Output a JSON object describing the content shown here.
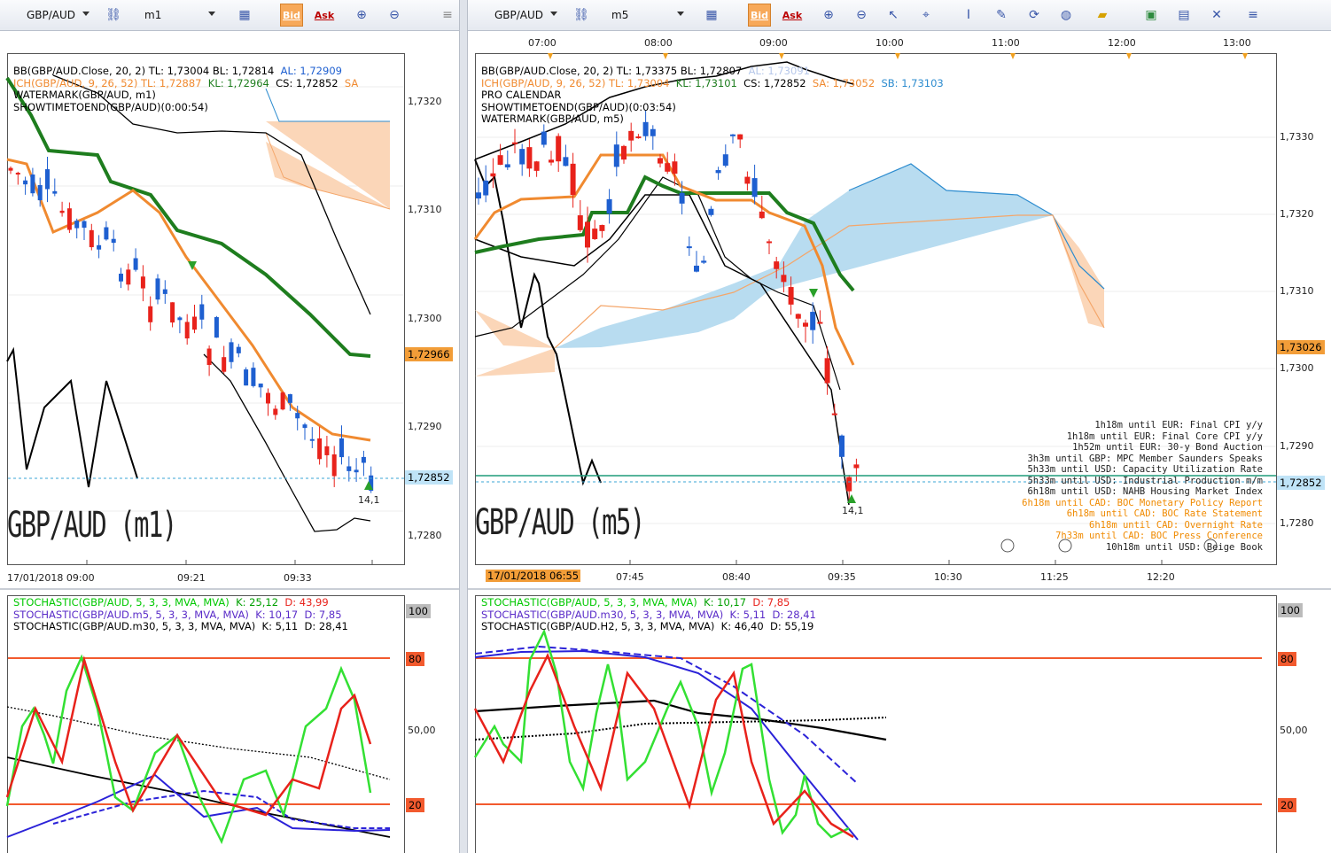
{
  "left": {
    "toolbar": {
      "symbol": "GBP/AUD",
      "timeframe": "m1",
      "bid": "Bid",
      "ask": "Ask"
    },
    "legend": [
      {
        "text": "BB(GBP/AUD.Close, 20, 2)  TL: 1,73004  BL: 1,72814",
        "extra": "AL: 1,72909"
      },
      {
        "text": "ICH(GBP/AUD, 9, 26, 52)  TL: 1,72887",
        "kl": "KL: 1,72964",
        "cs": "CS: 1,72852",
        "sa": "SA"
      },
      {
        "text": "WATERMARK(GBP/AUD, m1)"
      },
      {
        "text": "SHOWTIMETOEND(GBP/AUD)(0:00:54)"
      }
    ],
    "price_axis": [
      "1,7320",
      "1,7310",
      "1,7300",
      "1,7290",
      "1,7280"
    ],
    "tag_orange": "1,72966",
    "tag_blue": "1,72852",
    "time_axis": [
      "17/01/2018 09:00",
      "09:21",
      "09:33"
    ],
    "watermark": "GBP/AUD (m1)",
    "tick_label": "14,1",
    "stoch_legend": [
      {
        "label": "STOCHASTIC(GBP/AUD, 5, 3, 3, MVA, MVA)",
        "k": "K: 25,12",
        "d": "D: 43,99",
        "color": "#00c800"
      },
      {
        "label": "STOCHASTIC(GBP/AUD.m5, 5, 3, 3, MVA, MVA)",
        "k": "K: 10,17",
        "d": "D: 7,85",
        "color": "#5a2cc8"
      },
      {
        "label": "STOCHASTIC(GBP/AUD.m30, 5, 3, 3, MVA, MVA)",
        "k": "K: 5,11",
        "d": "D: 28,41",
        "color": "#000000"
      }
    ],
    "stoch_axis": [
      "100",
      "80",
      "50,00",
      "20"
    ]
  },
  "right": {
    "toolbar": {
      "symbol": "GBP/AUD",
      "timeframe": "m5",
      "bid": "Bid",
      "ask": "Ask"
    },
    "top_times": [
      "07:00",
      "08:00",
      "09:00",
      "10:00",
      "11:00",
      "12:00",
      "13:00"
    ],
    "legend": [
      {
        "text": "BB(GBP/AUD.Close, 20, 2)  TL: 1,73375  BL: 1,72807",
        "extra": "AL: 1,73091"
      },
      {
        "text": "ICH(GBP/AUD, 9, 26, 52)  TL: 1,73004",
        "kl": "KL: 1,73101",
        "cs": "CS: 1,72852",
        "sa": "SA: 1,73052",
        "sb": "SB: 1,73103"
      },
      {
        "text": "PRO CALENDAR"
      },
      {
        "text": "SHOWTIMETOEND(GBP/AUD)(0:03:54)"
      },
      {
        "text": "WATERMARK(GBP/AUD, m5)"
      }
    ],
    "price_axis": [
      "1,7330",
      "1,7320",
      "1,7310",
      "1,7300",
      "1,7290",
      "1,7280"
    ],
    "tag_orange": "1,73026",
    "tag_blue": "1,72852",
    "time_axis": [
      "07:45",
      "08:40",
      "09:35",
      "10:30",
      "11:25",
      "12:20"
    ],
    "date_tag": "17/01/2018 06:55",
    "watermark": "GBP/AUD (m5)",
    "tick_label": "14,1",
    "calendar": [
      {
        "text": "1h18m until EUR: Final CPI y/y",
        "color": "#222222"
      },
      {
        "text": "1h18m until EUR: Final Core CPI y/y",
        "color": "#222222"
      },
      {
        "text": "1h52m until EUR: 30-y Bond Auction",
        "color": "#222222"
      },
      {
        "text": "3h3m until GBP: MPC Member Saunders Speaks",
        "color": "#222222"
      },
      {
        "text": "5h33m until USD: Capacity Utilization Rate",
        "color": "#222222"
      },
      {
        "text": "5h33m until USD: Industrial Production m/m",
        "color": "#222222"
      },
      {
        "text": "6h18m until USD: NAHB Housing Market Index",
        "color": "#222222"
      },
      {
        "text": "6h18m until CAD: BOC Monetary Policy Report",
        "color": "#f08a00"
      },
      {
        "text": "6h18m until CAD: BOC Rate Statement",
        "color": "#f08a00"
      },
      {
        "text": "6h18m until CAD: Overnight Rate",
        "color": "#f08a00"
      },
      {
        "text": "7h33m until CAD: BOC Press Conference",
        "color": "#f08a00"
      },
      {
        "text": "10h18m until USD: Beige Book",
        "color": "#222222"
      }
    ],
    "stoch_legend": [
      {
        "label": "STOCHASTIC(GBP/AUD, 5, 3, 3, MVA, MVA)",
        "k": "K: 10,17",
        "d": "D: 7,85",
        "color": "#00c800"
      },
      {
        "label": "STOCHASTIC(GBP/AUD.m30, 5, 3, 3, MVA, MVA)",
        "k": "K: 5,11",
        "d": "D: 28,41",
        "color": "#5a2cc8"
      },
      {
        "label": "STOCHASTIC(GBP/AUD.H2, 5, 3, 3, MVA, MVA)",
        "k": "K: 46,40",
        "d": "D: 55,19",
        "color": "#000000"
      }
    ],
    "stoch_axis": [
      "100",
      "80",
      "50,00",
      "20"
    ]
  },
  "colors": {
    "up": "#1e5fd0",
    "down": "#e8221b",
    "kijun": "#1e7d1e",
    "tenkan": "#f08a30",
    "cloud_up": "#b8dcf0",
    "cloud_down": "#fbd6b8",
    "bid_bg": "#f7a95a"
  }
}
